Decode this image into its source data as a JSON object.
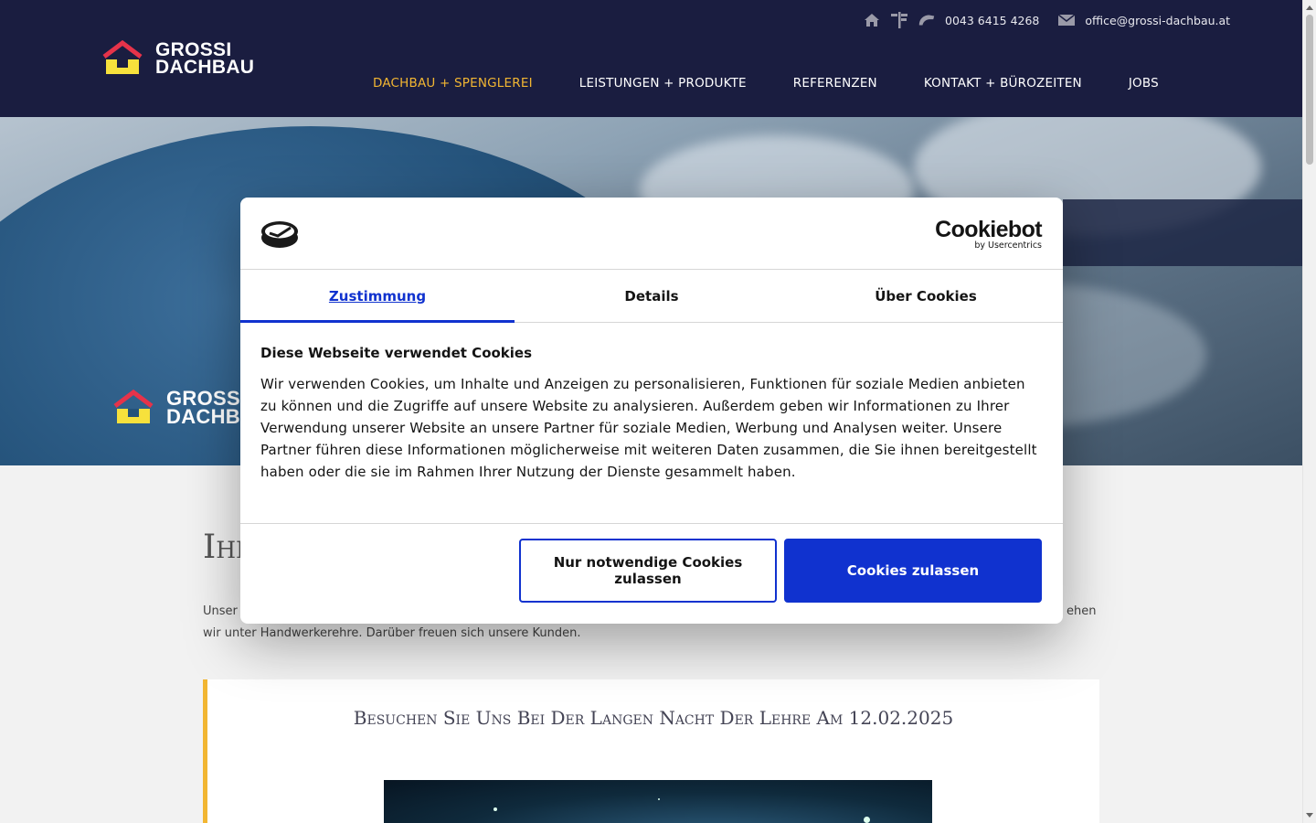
{
  "header": {
    "logo_line1": "GROSSI",
    "logo_line2": "DACHBAU",
    "phone": "0043 6415 4268",
    "email": "office@grossi-dachbau.at",
    "nav": [
      {
        "label": "DACHBAU + SPENGLEREI",
        "active": true
      },
      {
        "label": "LEISTUNGEN + PRODUKTE"
      },
      {
        "label": "REFERENZEN"
      },
      {
        "label": "KONTAKT + BÜROZEITEN"
      },
      {
        "label": "JOBS"
      }
    ]
  },
  "hero": {
    "logo_line1": "GROSSI",
    "logo_line2": "DACHBAU"
  },
  "content": {
    "title_visible": "Ihr",
    "text_left": "Unser",
    "text_right": "ehen",
    "text_line2": "wir unter Handwerkerehre. Darüber freuen sich unsere Kunden.",
    "card_title": "Besuchen Sie Uns Bei Der Langen Nacht Der Lehre Am 12.02.2025"
  },
  "cookie_dialog": {
    "brand": "Cookiebot",
    "brand_sub": "by Usercentrics",
    "tabs": [
      "Zustimmung",
      "Details",
      "Über Cookies"
    ],
    "heading": "Diese Webseite verwendet Cookies",
    "body": "Wir verwenden Cookies, um Inhalte und Anzeigen zu personalisieren, Funktionen für soziale Medien anbieten zu können und die Zugriffe auf unsere Website zu analysieren. Außerdem geben wir Informationen zu Ihrer Verwendung unserer Website an unsere Partner für soziale Medien, Werbung und Analysen weiter. Unsere Partner führen diese Informationen möglicherweise mit weiteren Daten zusammen, die Sie ihnen bereitgestellt haben oder die sie im Rahmen Ihrer Nutzung der Dienste gesammelt haben.",
    "btn_necessary": "Nur notwendige Cookies zulassen",
    "btn_allow": "Cookies zulassen"
  },
  "colors": {
    "header_bg": "#1a1d40",
    "accent_yellow": "#f2b632",
    "cookie_blue": "#1032cf",
    "logo_red": "#e6334a"
  },
  "icons": [
    "home-icon",
    "signpost-icon",
    "phone-icon",
    "mail-icon"
  ]
}
